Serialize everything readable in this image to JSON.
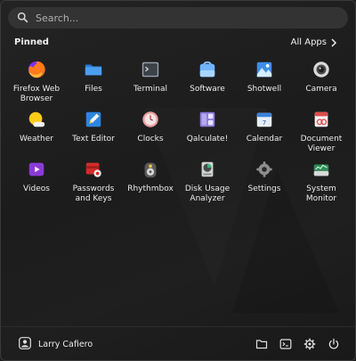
{
  "search": {
    "placeholder": "Search..."
  },
  "pinned": {
    "title": "Pinned",
    "all_apps_label": "All Apps"
  },
  "apps": [
    {
      "label": "Firefox Web Browser",
      "icon": "firefox-icon"
    },
    {
      "label": "Files",
      "icon": "folder-icon"
    },
    {
      "label": "Terminal",
      "icon": "terminal-icon"
    },
    {
      "label": "Software",
      "icon": "software-store-icon"
    },
    {
      "label": "Shotwell",
      "icon": "shotwell-icon"
    },
    {
      "label": "Camera",
      "icon": "camera-icon"
    },
    {
      "label": "Weather",
      "icon": "weather-icon"
    },
    {
      "label": "Text Editor",
      "icon": "text-editor-icon"
    },
    {
      "label": "Clocks",
      "icon": "clock-icon"
    },
    {
      "label": "Qalculate!",
      "icon": "calculator-icon"
    },
    {
      "label": "Calendar",
      "icon": "calendar-icon"
    },
    {
      "label": "Document Viewer",
      "icon": "document-viewer-icon"
    },
    {
      "label": "Videos",
      "icon": "videos-icon"
    },
    {
      "label": "Passwords and Keys",
      "icon": "passwords-keys-icon"
    },
    {
      "label": "Rhythmbox",
      "icon": "rhythmbox-icon"
    },
    {
      "label": "Disk Usage Analyzer",
      "icon": "disk-usage-icon"
    },
    {
      "label": "Settings",
      "icon": "settings-gear-icon"
    },
    {
      "label": "System Monitor",
      "icon": "system-monitor-icon"
    }
  ],
  "calendar_day": "7",
  "user": {
    "name": "Larry Cafiero"
  },
  "footer_buttons": [
    "file-manager-icon",
    "terminal-icon",
    "settings-icon",
    "power-icon"
  ],
  "colors": {
    "background": "#1e1e1e",
    "search_bg": "#333333",
    "text": "#ececec"
  }
}
